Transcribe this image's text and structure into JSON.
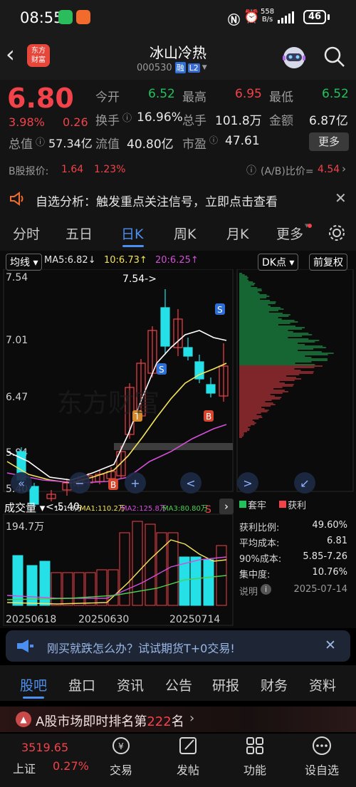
{
  "status_bar": {
    "time": "08:55",
    "net_speed_top": "558",
    "net_speed_bottom": "B/s",
    "battery": "46"
  },
  "header": {
    "title": "冰山冷热",
    "code": "000530",
    "margin_badge": "融",
    "level_badge": "L2",
    "logo_text_top": "东方",
    "logo_text_bottom": "财富"
  },
  "quote": {
    "price": "6.80",
    "change_pct": "3.98%",
    "change": "0.26",
    "open_label": "今开",
    "open": "6.52",
    "high_label": "最高",
    "high": "6.95",
    "low_label": "最低",
    "low": "6.52",
    "turnover_label": "换手",
    "turnover": "16.96%",
    "volume_label": "总手",
    "volume": "101.8万",
    "amount_label": "金额",
    "amount": "6.87亿",
    "mktcap_label": "总值",
    "mktcap": "57.34亿",
    "float_label": "流值",
    "float": "40.80亿",
    "pe_label": "市盈",
    "pe": "47.61",
    "more": "更多",
    "b_share_label": "B股报价:",
    "b_share_price": "1.64",
    "b_share_pct": "1.23%",
    "ab_label": "(A/B)比价=",
    "ab_value": "4.54"
  },
  "ticker": {
    "text": "自选分析：触发重点关注信号，立即点击查看"
  },
  "tabs": [
    "分时",
    "五日",
    "日K",
    "周K",
    "月K",
    "更多"
  ],
  "active_tab": "日K",
  "kline": {
    "ma_selector": "均线",
    "ma5": "MA5:6.82↓",
    "ma10": "10:6.73↑",
    "ma20": "20:6.25↑",
    "dk_btn": "DK点",
    "fq_btn": "前复权",
    "y_labels": [
      "7.54",
      "7.01",
      "6.47",
      "5.94",
      "5.40"
    ],
    "high_mark": "7.54->",
    "low_mark": "<-5.40",
    "volume_selector": "成交量",
    "vol_values": "101.8万",
    "vol_ma1": "MA1:110.2万",
    "vol_ma2": "MA2:125.8万",
    "vol_ma3": "MA3:80.80万",
    "vol_y_label": "194.7万",
    "dates": [
      "20250618",
      "20250630",
      "20250714"
    ]
  },
  "chip": {
    "legend_trapped": "套牢",
    "legend_profit": "获利",
    "rows": [
      {
        "label": "获利比例:",
        "value": "49.60%"
      },
      {
        "label": "平均成本:",
        "value": "6.81"
      },
      {
        "label": "90%成本:",
        "value": "5.85-7.26"
      },
      {
        "label": "集中度:",
        "value": "10.76%"
      }
    ],
    "note_label": "说明",
    "note_date": "2025-07-14"
  },
  "ad": {
    "text": "刚买就跌怎么办？试试期货T+0交易!"
  },
  "news_tabs": [
    "股吧",
    "盘口",
    "资讯",
    "公告",
    "研报",
    "财务",
    "资料"
  ],
  "rank": {
    "prefix": "A股市场即时排名第",
    "number": "222",
    "suffix": "名"
  },
  "bottom": {
    "index_value": "3519.65",
    "index_name": "上证",
    "index_pct": "0.27%",
    "items": [
      "交易",
      "发帖",
      "功能",
      "设自选"
    ]
  },
  "chart_data": {
    "type": "candlestick",
    "dates_labeled": [
      "20250618",
      "20250630",
      "20250714"
    ],
    "ylim": [
      5.4,
      7.54
    ],
    "high": 7.54,
    "low": 5.4,
    "ma5": 6.82,
    "ma10": 6.73,
    "ma20": 6.25,
    "vol_max": "194.7万"
  }
}
